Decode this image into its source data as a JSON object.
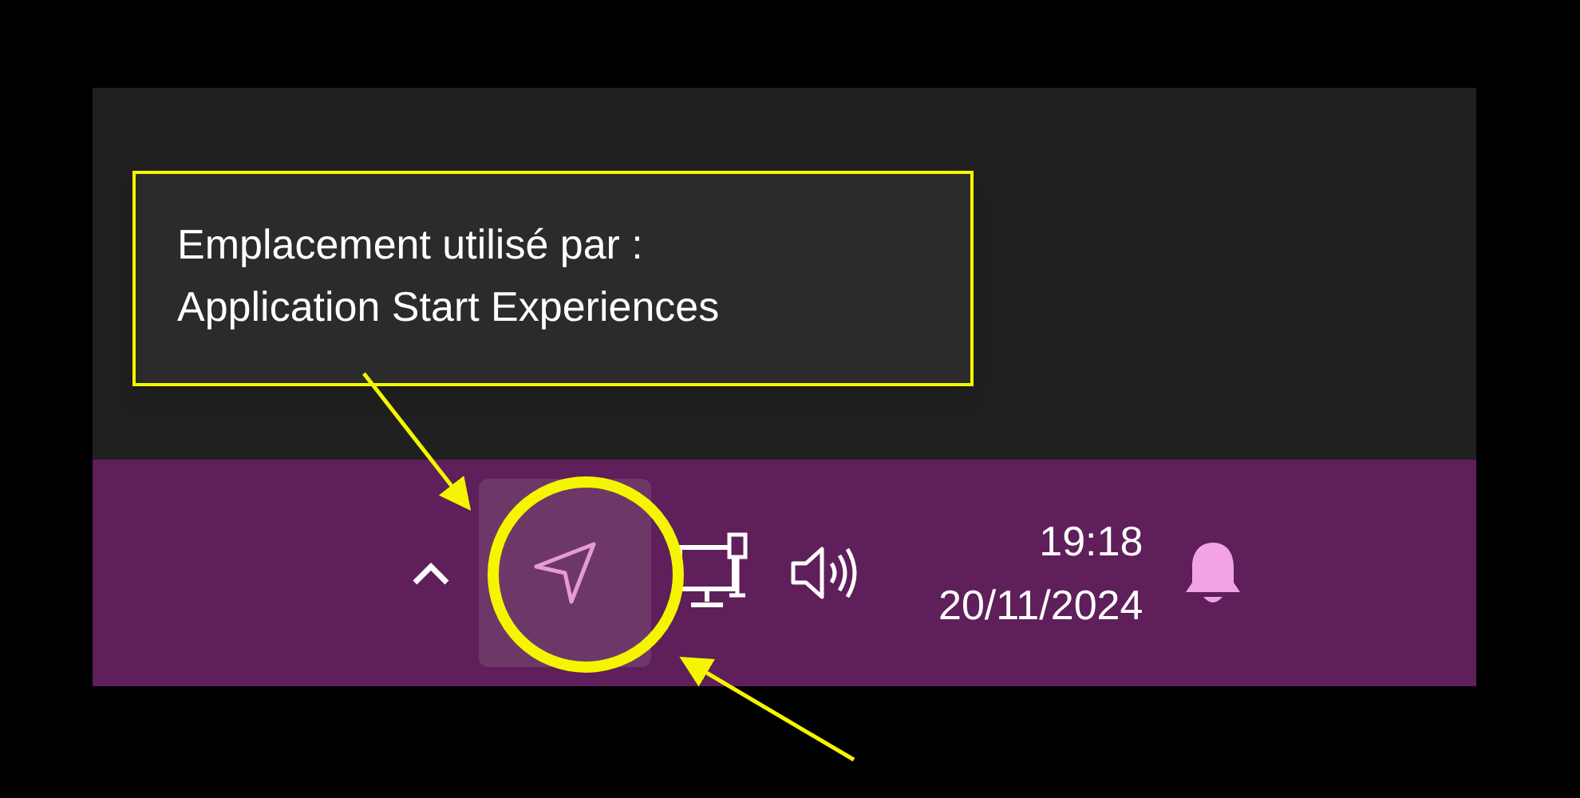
{
  "tooltip": {
    "lines": [
      "Emplacement utilisé par :",
      "Application Start Experiences"
    ]
  },
  "taskbar": {
    "tray_icons": [
      {
        "kind": "chevron",
        "hovered": false
      },
      {
        "kind": "location",
        "hovered": true
      },
      {
        "kind": "network",
        "hovered": false
      },
      {
        "kind": "volume",
        "hovered": false
      }
    ],
    "clock": {
      "time": "19:18",
      "date": "20/11/2024"
    }
  }
}
